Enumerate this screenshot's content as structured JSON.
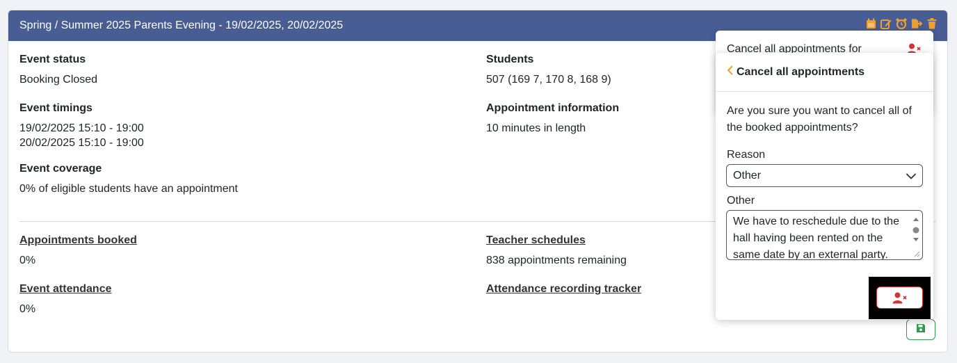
{
  "header": {
    "title": "Spring / Summer 2025 Parents Evening - 19/02/2025, 20/02/2025"
  },
  "header_icons": [
    "calendar-icon",
    "edit-icon",
    "alarm-icon",
    "export-icon",
    "trash-icon"
  ],
  "event_status": {
    "label": "Event status",
    "value": "Booking Closed"
  },
  "students": {
    "label": "Students",
    "value": "507 (169 7, 170 8, 168 9)"
  },
  "event_timings": {
    "label": "Event timings",
    "line1": "19/02/2025 15:10 - 19:00",
    "line2": "20/02/2025 15:10 - 19:00"
  },
  "appointment_info": {
    "label": "Appointment information",
    "value": "10 minutes in length"
  },
  "event_coverage": {
    "label": "Event coverage",
    "value": "0% of eligible students have an appointment"
  },
  "appointments_booked": {
    "label": "Appointments booked",
    "value": "0%"
  },
  "teacher_schedules": {
    "label": "Teacher schedules",
    "value": "838 appointments remaining"
  },
  "event_attendance": {
    "label": "Event attendance",
    "value": "0%"
  },
  "attendance_tracker": {
    "label": "Attendance recording tracker"
  },
  "back_popover": {
    "title": "Cancel all appointments for"
  },
  "popover": {
    "title": "Cancel all appointments",
    "question": "Are you sure you want to cancel all of the booked appointments?",
    "reason_label": "Reason",
    "reason_value": "Other",
    "other_label": "Other",
    "other_text": "We have to reschedule due to the hall having been rented on the same date by an external party."
  },
  "colors": {
    "header_bg": "#475d94",
    "icon_orange": "#f0a030",
    "danger": "#d33333",
    "success": "#2e9e4e"
  }
}
